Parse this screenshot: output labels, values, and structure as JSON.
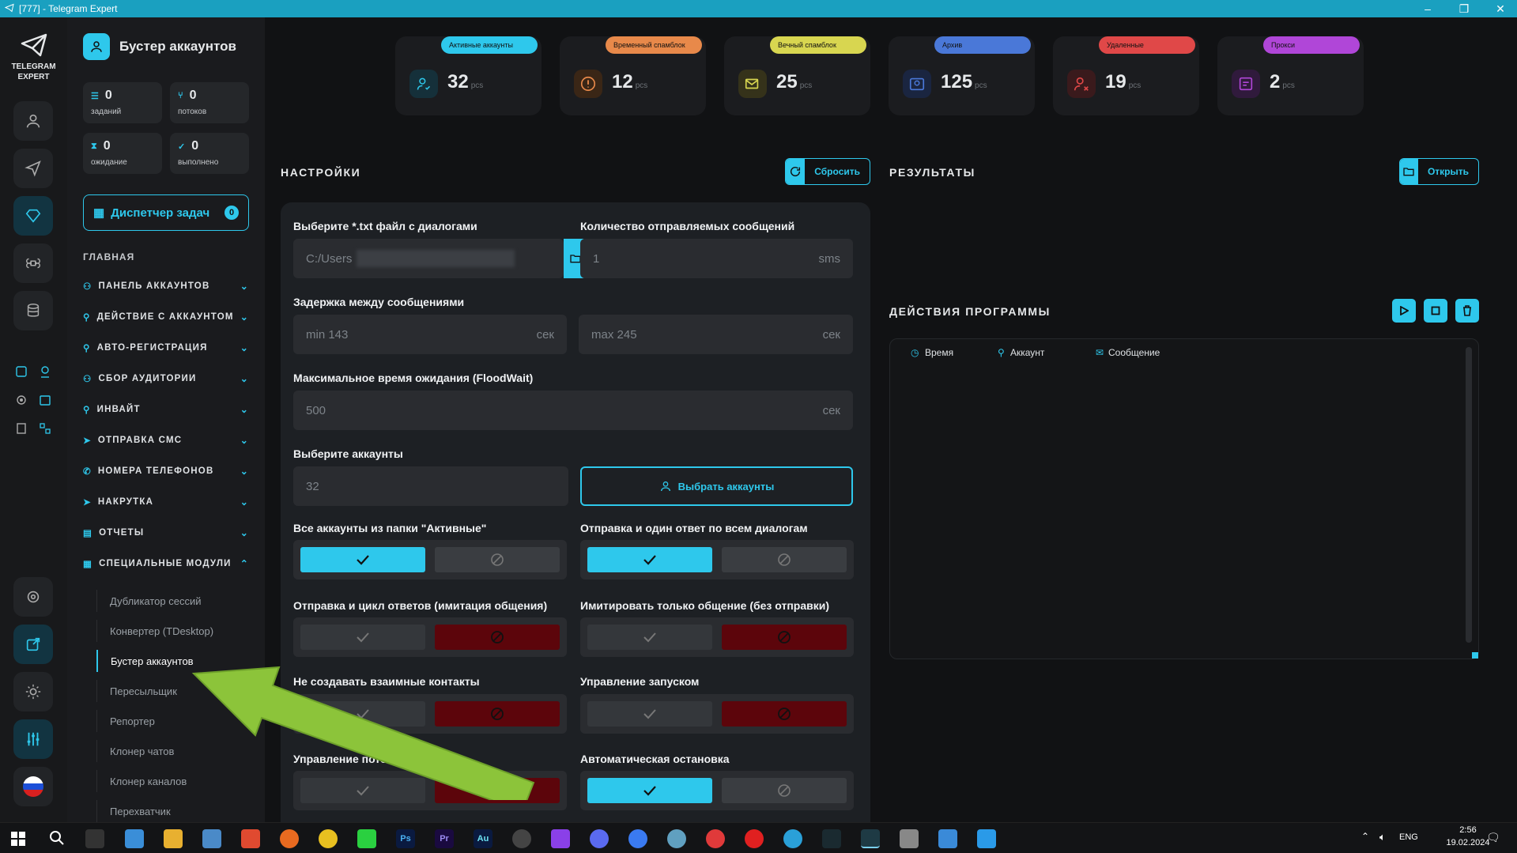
{
  "window": {
    "title": "[777] - Telegram Expert"
  },
  "rail": {
    "logo_line1": "TELEGRAM",
    "logo_line2": "EXPERT"
  },
  "sidebar": {
    "title": "Бустер аккаунтов",
    "stats": [
      {
        "value": "0",
        "label": "заданий"
      },
      {
        "value": "0",
        "label": "потоков"
      },
      {
        "value": "0",
        "label": "ожидание"
      },
      {
        "value": "0",
        "label": "выполнено"
      }
    ],
    "dispatcher": {
      "label": "Диспетчер задач",
      "count": "0"
    },
    "section": "ГЛАВНАЯ",
    "nav": [
      "ПАНЕЛЬ АККАУНТОВ",
      "ДЕЙСТВИЕ С АККАУНТОМ",
      "АВТО-РЕГИСТРАЦИЯ",
      "СБОР АУДИТОРИИ",
      "ИНВАЙТ",
      "ОТПРАВКА СМС",
      "НОМЕРА ТЕЛЕФОНОВ",
      "НАКРУТКА",
      "ОТЧЕТЫ",
      "СПЕЦИАЛЬНЫЕ МОДУЛИ"
    ],
    "submenu": [
      "Дубликатор сессий",
      "Конвертер (TDesktop)",
      "Бустер аккаунтов",
      "Пересыльщик",
      "Репортер",
      "Клонер чатов",
      "Клонер каналов",
      "Перехватчик"
    ]
  },
  "cards": [
    {
      "pill": "Активные аккаунты",
      "value": "32",
      "unit": "pcs",
      "color": "#2ec8ec"
    },
    {
      "pill": "Временный спамблок",
      "value": "12",
      "unit": "pcs",
      "color": "#e8894a"
    },
    {
      "pill": "Вечный спамблок",
      "value": "25",
      "unit": "pcs",
      "color": "#d8d650"
    },
    {
      "pill": "Архив",
      "value": "125",
      "unit": "pcs",
      "color": "#4a78d8"
    },
    {
      "pill": "Удаленные",
      "value": "19",
      "unit": "pcs",
      "color": "#e04848"
    },
    {
      "pill": "Прокси",
      "value": "2",
      "unit": "pcs",
      "color": "#b046d8"
    }
  ],
  "settings": {
    "heading": "НАСТРОЙКИ",
    "reset_label": "Сбросить",
    "file_label": "Выберите *.txt файл с диалогами",
    "file_value": "C:/Users",
    "count_label": "Количество отправляемых сообщений",
    "count_placeholder": "1",
    "count_unit": "sms",
    "delay_label": "Задержка между сообщениями",
    "delay_min": "min  143",
    "delay_max": "max  245",
    "sec_unit": "сек",
    "flood_label": "Максимальное время ожидания (FloodWait)",
    "flood_value": "500",
    "accounts_label": "Выберите аккаунты",
    "accounts_value": "32",
    "select_accounts_label": "Выбрать аккаунты",
    "toggles": [
      {
        "label": "Все аккаунты из папки \"Активные\"",
        "on": true
      },
      {
        "label": "Отправка и один ответ по всем диалогам",
        "on": true
      },
      {
        "label": "Отправка и цикл ответов (имитация общения)",
        "on": false
      },
      {
        "label": "Имитировать только общение (без отправки)",
        "on": false
      },
      {
        "label": "Не создавать взаимные контакты",
        "on": false
      },
      {
        "label": "Управление запуском",
        "on": false
      },
      {
        "label": "Управление потоками",
        "on": false
      },
      {
        "label": "Автоматическая остановка",
        "on": true
      }
    ]
  },
  "results": {
    "heading": "РЕЗУЛЬТАТЫ",
    "open_label": "Открыть"
  },
  "actions": {
    "heading": "ДЕЙСТВИЯ ПРОГРАММЫ",
    "col_time": "Время",
    "col_account": "Аккаунт",
    "col_message": "Сообщение"
  },
  "taskbar": {
    "lang": "ENG",
    "time": "2:56",
    "date": "19.02.2024"
  }
}
